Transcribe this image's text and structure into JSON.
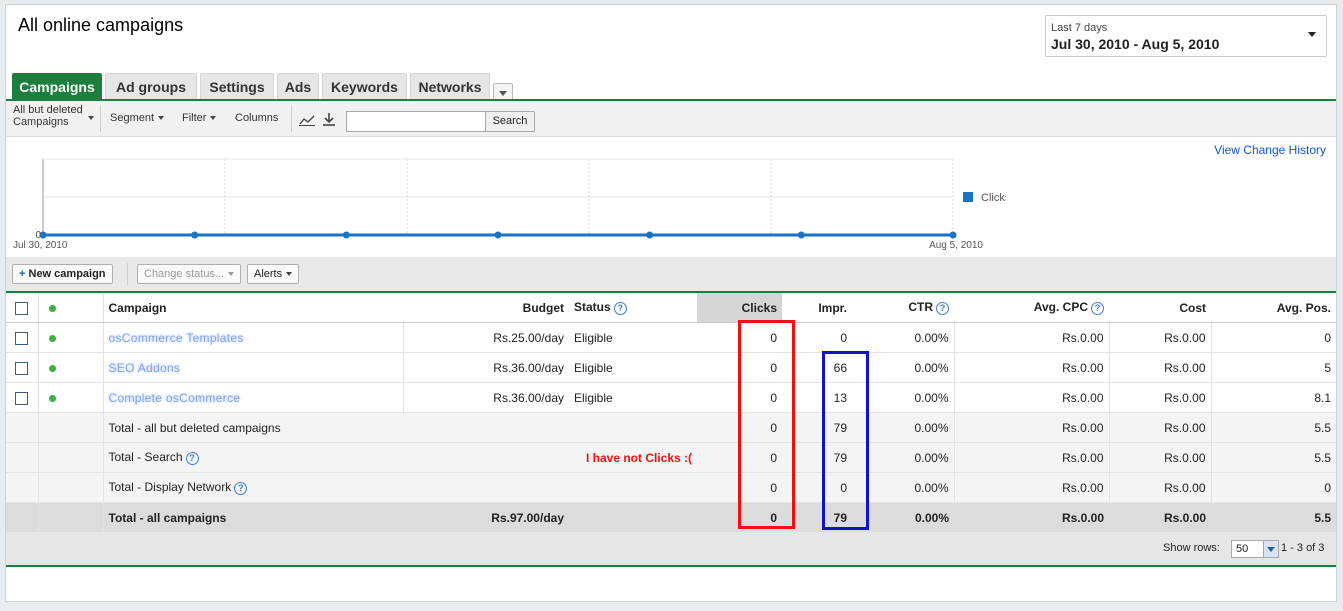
{
  "page": {
    "title": "All online campaigns"
  },
  "date_range": {
    "label": "Last 7 days",
    "range": "Jul 30, 2010 - Aug 5, 2010"
  },
  "tabs": [
    {
      "label": "Campaigns",
      "active": true
    },
    {
      "label": "Ad groups"
    },
    {
      "label": "Settings"
    },
    {
      "label": "Ads"
    },
    {
      "label": "Keywords"
    },
    {
      "label": "Networks"
    }
  ],
  "toolbar": {
    "view_line1": "All but deleted",
    "view_line2": "Campaigns",
    "segment": "Segment",
    "filter": "Filter",
    "columns": "Columns",
    "search_value": "",
    "search_button": "Search"
  },
  "chart_link": "View Change History",
  "chart_data": {
    "type": "line",
    "x": [
      "Jul 30, 2010",
      "Jul 31, 2010",
      "Aug 1, 2010",
      "Aug 2, 2010",
      "Aug 3, 2010",
      "Aug 4, 2010",
      "Aug 5, 2010"
    ],
    "x_tick_labels": [
      "Jul 30, 2010",
      "Aug 5, 2010"
    ],
    "series": [
      {
        "name": "Clicks",
        "values": [
          0,
          0,
          0,
          0,
          0,
          0,
          0
        ],
        "color": "#1a73c8"
      }
    ],
    "y_tick_labels": [
      "0"
    ],
    "ylim": [
      0,
      1
    ],
    "legend": "right",
    "grid": true
  },
  "actions": {
    "new_campaign": "New campaign",
    "change_status": "Change status...",
    "alerts": "Alerts"
  },
  "table": {
    "headers": {
      "campaign": "Campaign",
      "budget": "Budget",
      "status": "Status",
      "clicks": "Clicks",
      "impr": "Impr.",
      "ctr": "CTR",
      "cpc": "Avg. CPC",
      "cost": "Cost",
      "pos": "Avg. Pos."
    },
    "rows": [
      {
        "campaign": "osCommerce Templates",
        "budget": "Rs.25.00/day",
        "status": "Eligible",
        "clicks": "0",
        "impr": "0",
        "ctr": "0.00%",
        "cpc": "Rs.0.00",
        "cost": "Rs.0.00",
        "pos": "0"
      },
      {
        "campaign": "SEO Addons",
        "budget": "Rs.36.00/day",
        "status": "Eligible",
        "clicks": "0",
        "impr": "66",
        "ctr": "0.00%",
        "cpc": "Rs.0.00",
        "cost": "Rs.0.00",
        "pos": "5"
      },
      {
        "campaign": "Complete osCommerce",
        "budget": "Rs.36.00/day",
        "status": "Eligible",
        "clicks": "0",
        "impr": "13",
        "ctr": "0.00%",
        "cpc": "Rs.0.00",
        "cost": "Rs.0.00",
        "pos": "8.1"
      }
    ],
    "totals": [
      {
        "label": "Total - all but deleted campaigns",
        "note": "",
        "clicks": "0",
        "impr": "79",
        "ctr": "0.00%",
        "cpc": "Rs.0.00",
        "cost": "Rs.0.00",
        "pos": "5.5"
      },
      {
        "label": "Total - Search",
        "note": "I have not Clicks :(",
        "clicks": "0",
        "impr": "79",
        "ctr": "0.00%",
        "cpc": "Rs.0.00",
        "cost": "Rs.0.00",
        "pos": "5.5"
      },
      {
        "label": "Total - Display Network",
        "note": "",
        "clicks": "0",
        "impr": "0",
        "ctr": "0.00%",
        "cpc": "Rs.0.00",
        "cost": "Rs.0.00",
        "pos": "0"
      }
    ],
    "grand_total": {
      "label": "Total - all campaigns",
      "budget": "Rs.97.00/day",
      "clicks": "0",
      "impr": "79",
      "ctr": "0.00%",
      "cpc": "Rs.0.00",
      "cost": "Rs.0.00",
      "pos": "5.5"
    }
  },
  "pagination": {
    "show_rows_label": "Show rows:",
    "rows_value": "50",
    "range": "1 - 3 of 3"
  },
  "colors": {
    "brand_green": "#1c7f3d",
    "link_blue": "#1155cc",
    "annotation_red": "#ee1111",
    "annotation_blue": "#1111cc"
  }
}
